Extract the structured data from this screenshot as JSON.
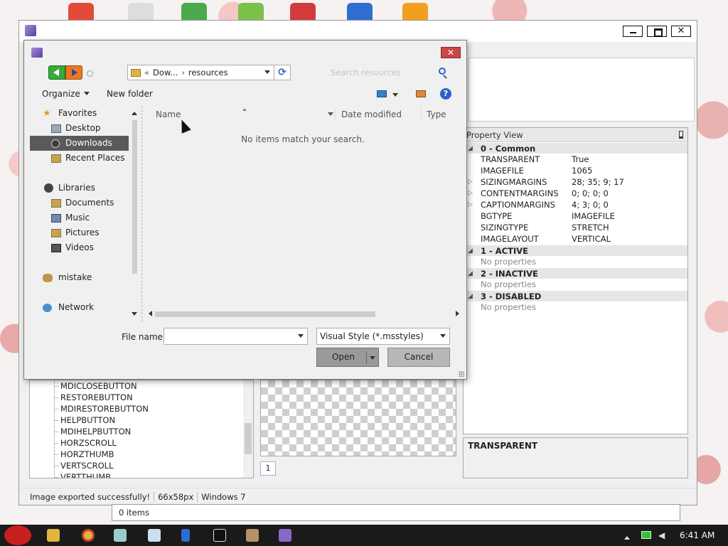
{
  "app": {
    "status": [
      "Image exported successfully!",
      "66x58px",
      "Windows 7"
    ],
    "behind_status": "0 items",
    "property_view": {
      "title": "Property View",
      "rows": [
        {
          "kind": "cat",
          "label": "0 - Common"
        },
        {
          "kind": "prop",
          "key": "TRANSPARENT",
          "value": "True"
        },
        {
          "kind": "prop",
          "key": "IMAGEFILE",
          "value": "1065"
        },
        {
          "kind": "prop",
          "key": "SIZINGMARGINS",
          "value": "28; 35; 9; 17",
          "expandable": true
        },
        {
          "kind": "prop",
          "key": "CONTENTMARGINS",
          "value": "0; 0; 0; 0",
          "expandable": true
        },
        {
          "kind": "prop",
          "key": "CAPTIONMARGINS",
          "value": "4; 3; 0; 0",
          "expandable": true
        },
        {
          "kind": "prop",
          "key": "BGTYPE",
          "value": "IMAGEFILE"
        },
        {
          "kind": "prop",
          "key": "SIZINGTYPE",
          "value": "STRETCH"
        },
        {
          "kind": "prop",
          "key": "IMAGELAYOUT",
          "value": "VERTICAL"
        },
        {
          "kind": "cat",
          "label": "1 - ACTIVE"
        },
        {
          "kind": "none",
          "label": "No properties"
        },
        {
          "kind": "cat",
          "label": "2 - INACTIVE"
        },
        {
          "kind": "none",
          "label": "No properties"
        },
        {
          "kind": "cat",
          "label": "3 - DISABLED"
        },
        {
          "kind": "none",
          "label": "No properties"
        }
      ]
    },
    "description": "TRANSPARENT",
    "tree_items": [
      "MDICLOSEBUTTON",
      "RESTOREBUTTON",
      "MDIRESTOREBUTTON",
      "HELPBUTTON",
      "MDIHELPBUTTON",
      "HORZSCROLL",
      "HORZTHUMB",
      "VERTSCROLL",
      "VERTTHUMB"
    ],
    "page_number": "1"
  },
  "dialog": {
    "address": {
      "part1": "Dow...",
      "part2": "resources",
      "prefix": "«",
      "separator": "›"
    },
    "search_placeholder": "Search resources",
    "toolbar": {
      "organize": "Organize",
      "new_folder": "New folder"
    },
    "nav": {
      "favorites": "Favorites",
      "desktop": "Desktop",
      "downloads": "Downloads",
      "recent_places": "Recent Places",
      "libraries": "Libraries",
      "documents": "Documents",
      "music": "Music",
      "pictures": "Pictures",
      "videos": "Videos",
      "mistake": "mistake",
      "network": "Network"
    },
    "columns": {
      "name": "Name",
      "date_modified": "Date modified",
      "type": "Type"
    },
    "empty_message": "No items match your search.",
    "file_name_label": "File name:",
    "file_name_value": "",
    "file_type": "Visual Style (*.msstyles)",
    "open_label": "Open",
    "cancel_label": "Cancel",
    "close_glyph": "✕"
  },
  "taskbar": {
    "clock": "6:41 AM"
  },
  "colors": {
    "selected_nav": "#5a5a5a",
    "dialog_close": "#c94747",
    "accent_blue": "#2b63c6"
  }
}
